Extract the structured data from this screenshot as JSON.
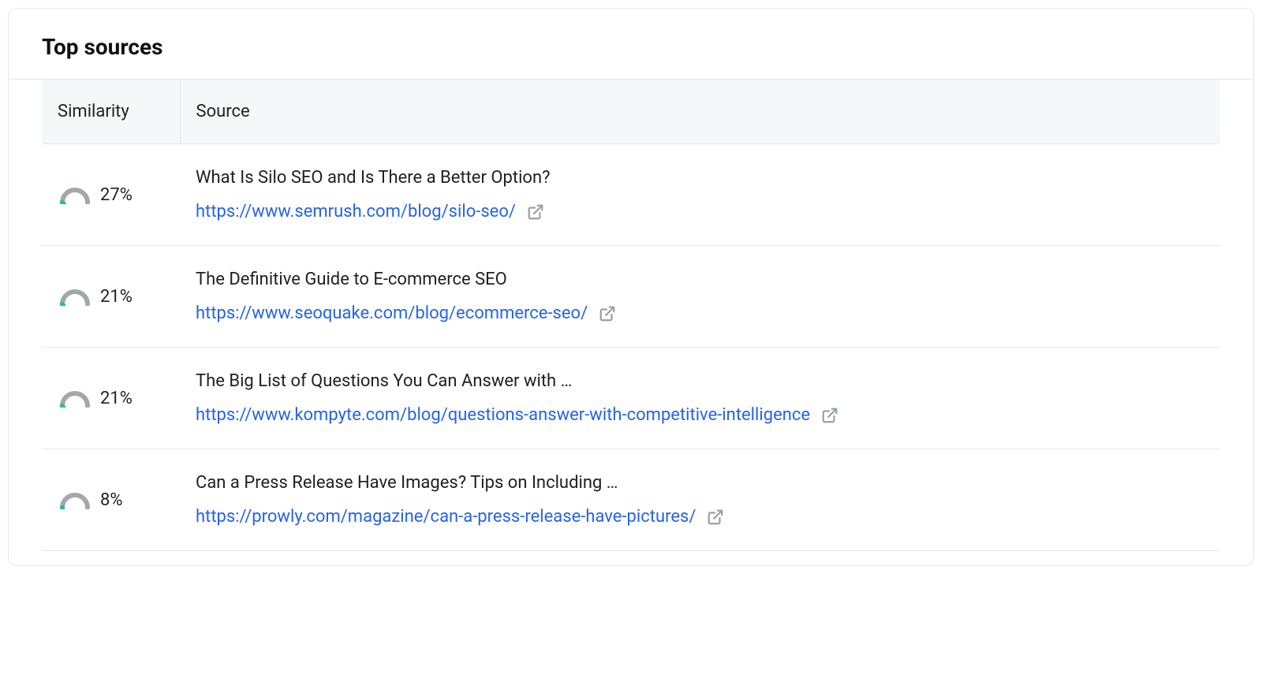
{
  "header": {
    "title": "Top sources"
  },
  "table": {
    "columns": {
      "similarity": "Similarity",
      "source": "Source"
    },
    "rows": [
      {
        "similarity_label": "27%",
        "similarity_percent": 27,
        "title": "What Is Silo SEO and Is There a Better Option?",
        "url": "https://www.semrush.com/blog/silo-seo/"
      },
      {
        "similarity_label": "21%",
        "similarity_percent": 21,
        "title": "The Definitive Guide to E-commerce SEO",
        "url": "https://www.seoquake.com/blog/ecommerce-seo/"
      },
      {
        "similarity_label": "21%",
        "similarity_percent": 21,
        "title": "The Big List of Questions You Can Answer with …",
        "url": "https://www.kompyte.com/blog/questions-answer-with-competitive-intelligence"
      },
      {
        "similarity_label": "8%",
        "similarity_percent": 8,
        "title": "Can a Press Release Have Images? Tips on Including …",
        "url": "https://prowly.com/magazine/can-a-press-release-have-pictures/"
      }
    ]
  },
  "colors": {
    "gauge_track": "#a3a7ad",
    "gauge_fill": "#22c08b",
    "link": "#2563eb",
    "icon_muted": "#9aa0a6"
  }
}
